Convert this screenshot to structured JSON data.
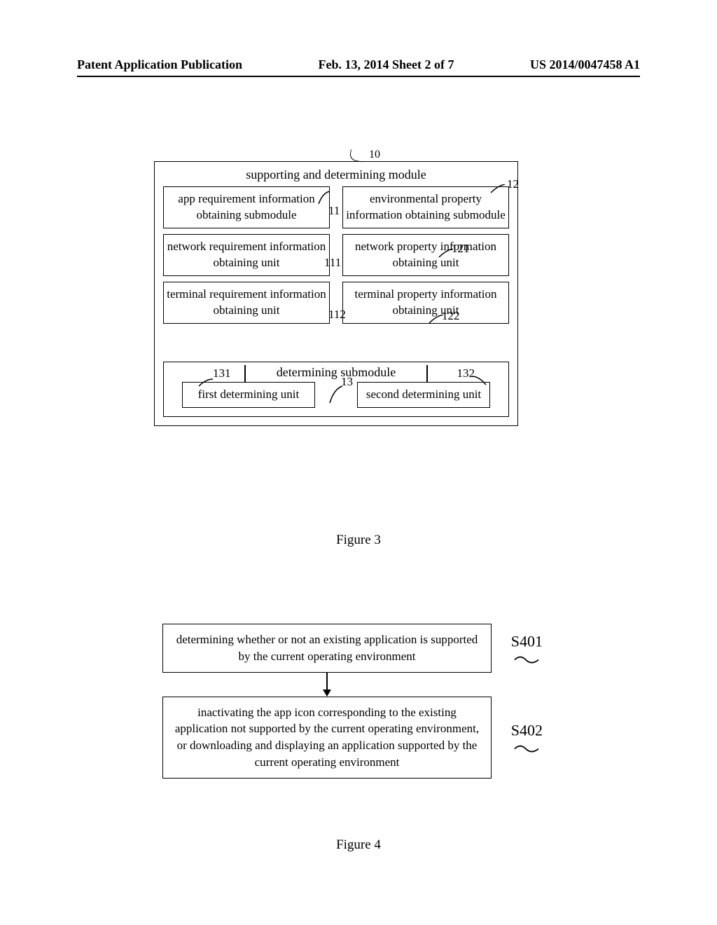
{
  "header": {
    "left": "Patent Application Publication",
    "center": "Feb. 13, 2014  Sheet 2 of 7",
    "right": "US 2014/0047458 A1"
  },
  "fig3": {
    "module_ref": "10",
    "module_title": "supporting and determining module",
    "left_sub_ref": "11",
    "left_sub_label": "app requirement information obtaining submodule",
    "left_unit1_ref": "111",
    "left_unit1_label": "network requirement information obtaining unit",
    "left_unit2_ref": "112",
    "left_unit2_label": "terminal requirement information obtaining unit",
    "right_sub_ref": "12",
    "right_sub_label": "environmental property information obtaining submodule",
    "right_unit1_ref": "121",
    "right_unit1_label": "network property information obtaining unit",
    "right_unit2_ref": "122",
    "right_unit2_label": "terminal property information obtaining unit",
    "bottom_sub_ref": "13",
    "bottom_sub_title": "determining submodule",
    "bottom_unit1_ref": "131",
    "bottom_unit1_label": "first determining unit",
    "bottom_unit2_ref": "132",
    "bottom_unit2_label": "second determining unit",
    "caption": "Figure 3"
  },
  "fig4": {
    "step1_ref": "S401",
    "step1_text": "determining whether or not an existing application is supported by the current operating environment",
    "step2_ref": "S402",
    "step2_text": "inactivating the app icon corresponding to the existing application not supported by the current operating environment, or downloading and displaying an application supported by the current operating environment",
    "caption": "Figure 4"
  },
  "chart_data": [
    {
      "type": "block-diagram",
      "title": "Figure 3",
      "root": {
        "id": "10",
        "label": "supporting and determining module",
        "children": [
          {
            "id": "11",
            "label": "app requirement information obtaining submodule",
            "children": [
              {
                "id": "111",
                "label": "network requirement information obtaining unit"
              },
              {
                "id": "112",
                "label": "terminal requirement information obtaining unit"
              }
            ]
          },
          {
            "id": "12",
            "label": "environmental property information obtaining submodule",
            "children": [
              {
                "id": "121",
                "label": "network property information obtaining unit"
              },
              {
                "id": "122",
                "label": "terminal property information obtaining unit"
              }
            ]
          },
          {
            "id": "13",
            "label": "determining submodule",
            "children": [
              {
                "id": "131",
                "label": "first determining unit"
              },
              {
                "id": "132",
                "label": "second determining unit"
              }
            ]
          }
        ]
      },
      "edges": [
        {
          "from": "11",
          "to": "13"
        },
        {
          "from": "12",
          "to": "13"
        }
      ]
    },
    {
      "type": "flowchart",
      "title": "Figure 4",
      "steps": [
        {
          "id": "S401",
          "text": "determining whether or not an existing application is supported by the current operating environment"
        },
        {
          "id": "S402",
          "text": "inactivating the app icon corresponding to the existing application not supported by the current operating environment, or downloading and displaying an application supported by the current operating environment"
        }
      ],
      "edges": [
        {
          "from": "S401",
          "to": "S402"
        }
      ]
    }
  ]
}
